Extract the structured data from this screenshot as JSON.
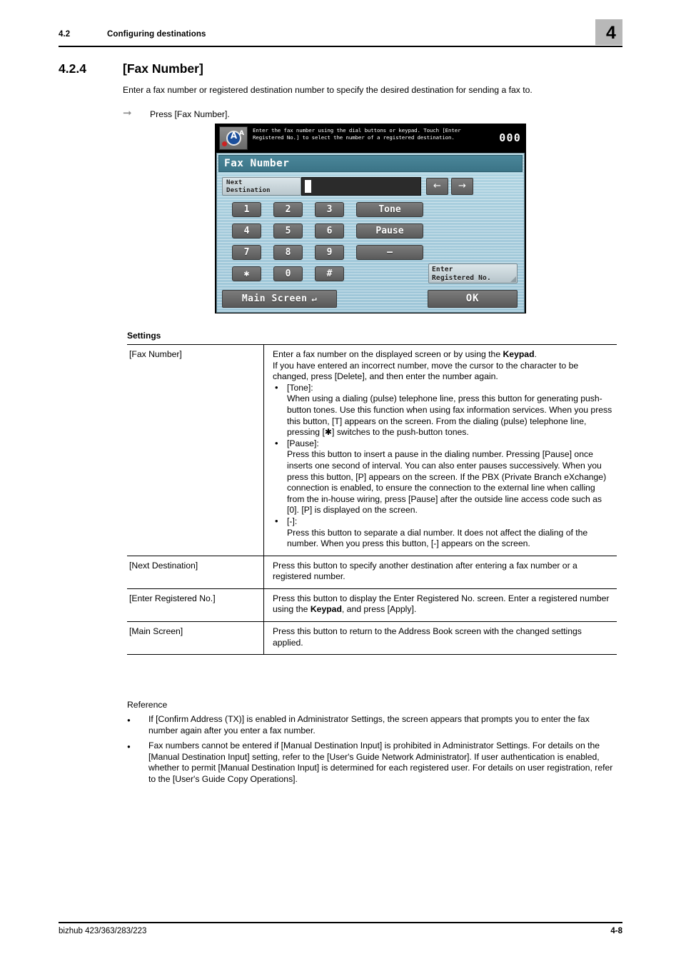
{
  "header": {
    "section_number": "4.2",
    "section_title": "Configuring destinations",
    "chapter_badge": "4"
  },
  "section": {
    "number": "4.2.4",
    "title": "[Fax Number]",
    "intro": "Enter a fax number or registered destination number to specify the desired destination for sending a fax to.",
    "step": "Press [Fax Number]."
  },
  "panel": {
    "status_message": "Enter the fax number using the dial buttons or keypad. Touch [Enter Registered No.] to select the number of a registered destination.",
    "counter": "000",
    "title": "Fax Number",
    "next_destination_line1": "Next",
    "next_destination_line2": "Destination",
    "input_value": "",
    "arrow_left": "←",
    "arrow_right": "→",
    "keys": [
      "1",
      "2",
      "3",
      "4",
      "5",
      "6",
      "7",
      "8",
      "9",
      "✱",
      "0",
      "#"
    ],
    "function_keys": [
      "Tone",
      "Pause",
      "–"
    ],
    "enter_registered_line1": "Enter",
    "enter_registered_line2": "Registered No.",
    "main_screen": "Main Screen",
    "main_screen_glyph": "↵",
    "ok": "OK",
    "colors": {
      "title_bar": "#3b7487",
      "panel_background": "#a6ccdc",
      "key_face": "#6b6b6b",
      "status_bar": "#000000"
    }
  },
  "settings": {
    "heading": "Settings",
    "rows": [
      {
        "name": "[Fax Number]",
        "intro_lines": [
          "Enter a fax number on the displayed screen or by using the ",
          "If you have entered an incorrect number, move the cursor to the character to be changed, press [Delete], and then enter the number again."
        ],
        "keypad_bold": "Keypad",
        "intro_tail": ".",
        "bullets": [
          {
            "label": "[Tone]:",
            "text": "When using a dialing (pulse) telephone line, press this button for generating push-button tones. Use this function when using fax information services. When you press this button, [T] appears on the screen. From the dialing (pulse) telephone line, pressing [✱] switches to the push-button tones."
          },
          {
            "label": "[Pause]:",
            "text": "Press this button to insert a pause in the dialing number. Pressing [Pause] once inserts one second of interval. You can also enter pauses successively. When you press this button, [P] appears on the screen. If the PBX (Private Branch eXchange) connection is enabled, to ensure the connection to the external line when calling from the in-house wiring, press [Pause] after the outside line access code such as [0]. [P] is displayed on the screen."
          },
          {
            "label": "[-]:",
            "text": "Press this button to separate a dial number. It does not affect the dialing of the number. When you press this button, [-] appears on the screen."
          }
        ]
      },
      {
        "name": "[Next Destination]",
        "description": "Press this button to specify another destination after entering a fax number or a registered number."
      },
      {
        "name": "[Enter Registered No.]",
        "description_pre": "Press this button to display the Enter Registered No. screen. Enter a registered number using the ",
        "keypad_bold": "Keypad",
        "description_post": ", and press [Apply]."
      },
      {
        "name": "[Main Screen]",
        "description": "Press this button to return to the Address Book screen with the changed settings applied."
      }
    ]
  },
  "reference": {
    "title": "Reference",
    "items": [
      "If [Confirm Address (TX)] is enabled in Administrator Settings, the screen appears that prompts you to enter the fax number again after you enter a fax number.",
      "Fax numbers cannot be entered if [Manual Destination Input] is prohibited in Administrator Settings. For details on the [Manual Destination Input] setting, refer to the [User's Guide Network Administrator]. If user authentication is enabled, whether to permit [Manual Destination Input] is determined for each registered user. For details on user registration, refer to the [User's Guide Copy Operations]."
    ]
  },
  "footer": {
    "left": "bizhub 423/363/283/223",
    "right": "4-8"
  }
}
